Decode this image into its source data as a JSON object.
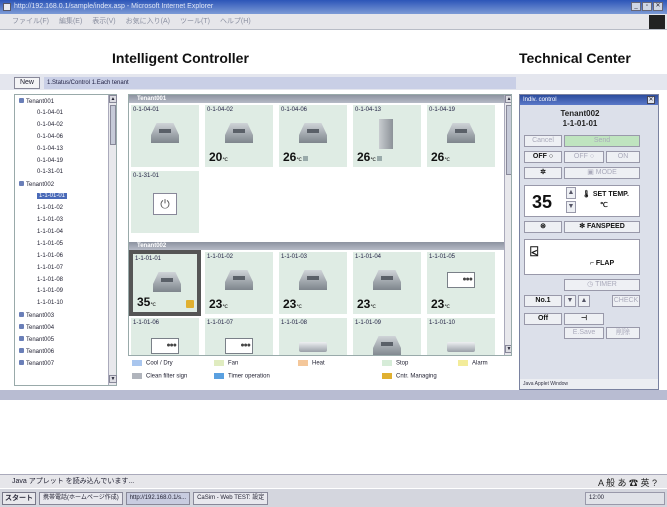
{
  "window": {
    "title": "http://192.168.0.1/sample/index.asp - Microsoft Internet Explorer",
    "menu": [
      "ファイル(F)",
      "編集(E)",
      "表示(V)",
      "お気に入り(A)",
      "ツール(T)",
      "ヘルプ(H)"
    ]
  },
  "header": {
    "left_title": "Intelligent Controller",
    "right_title": "Technical Center"
  },
  "tabbar": {
    "new_label": "New",
    "breadcrumb": "1.Status/Control  1.Each tenant"
  },
  "tree": [
    {
      "label": "Tenant001",
      "level": 0
    },
    {
      "label": "0-1-04-01",
      "level": 1
    },
    {
      "label": "0-1-04-02",
      "level": 1
    },
    {
      "label": "0-1-04-06",
      "level": 1
    },
    {
      "label": "0-1-04-13",
      "level": 1
    },
    {
      "label": "0-1-04-19",
      "level": 1
    },
    {
      "label": "0-1-31-01",
      "level": 1
    },
    {
      "label": "Tenant002",
      "level": 0
    },
    {
      "label": "1-1-01-01",
      "level": 1,
      "selected": true
    },
    {
      "label": "1-1-01-02",
      "level": 1
    },
    {
      "label": "1-1-01-03",
      "level": 1
    },
    {
      "label": "1-1-01-04",
      "level": 1
    },
    {
      "label": "1-1-01-05",
      "level": 1
    },
    {
      "label": "1-1-01-06",
      "level": 1
    },
    {
      "label": "1-1-01-07",
      "level": 1
    },
    {
      "label": "1-1-01-08",
      "level": 1
    },
    {
      "label": "1-1-01-09",
      "level": 1
    },
    {
      "label": "1-1-01-10",
      "level": 1
    },
    {
      "label": "Tenant003",
      "level": 0
    },
    {
      "label": "Tenant004",
      "level": 0
    },
    {
      "label": "Tenant005",
      "level": 0
    },
    {
      "label": "Tenant006",
      "level": 0
    },
    {
      "label": "Tenant007",
      "level": 0
    }
  ],
  "groups": [
    {
      "name": "Tenant001"
    },
    {
      "name": "Tenant002"
    }
  ],
  "units": [
    {
      "id": "0-1-04-01",
      "temp": "",
      "unit": ""
    },
    {
      "id": "0-1-04-02",
      "temp": "20",
      "unit": "℃"
    },
    {
      "id": "0-1-04-06",
      "temp": "26",
      "unit": "℃"
    },
    {
      "id": "0-1-04-13",
      "temp": "26",
      "unit": "℃"
    },
    {
      "id": "0-1-04-19",
      "temp": "26",
      "unit": "℃"
    },
    {
      "id": "0-1-31-01",
      "temp": "",
      "unit": ""
    },
    {
      "id": "1-1-01-01",
      "temp": "35",
      "unit": "℃"
    },
    {
      "id": "1-1-01-02",
      "temp": "23",
      "unit": "℃"
    },
    {
      "id": "1-1-01-03",
      "temp": "23",
      "unit": "℃"
    },
    {
      "id": "1-1-01-04",
      "temp": "23",
      "unit": "℃"
    },
    {
      "id": "1-1-01-05",
      "temp": "23",
      "unit": "℃"
    },
    {
      "id": "1-1-01-06",
      "temp": "",
      "unit": ""
    },
    {
      "id": "1-1-01-07",
      "temp": "",
      "unit": ""
    },
    {
      "id": "1-1-01-08",
      "temp": "",
      "unit": ""
    },
    {
      "id": "1-1-01-09",
      "temp": "",
      "unit": ""
    },
    {
      "id": "1-1-01-10",
      "temp": "",
      "unit": ""
    }
  ],
  "legend": [
    {
      "label": "Cool / Dry",
      "color": "#a9c6ee"
    },
    {
      "label": "Fan",
      "color": "#e0ecc0"
    },
    {
      "label": "Heat",
      "color": "#f4c79a"
    },
    {
      "label": "Stop",
      "color": "#d6ecd8"
    },
    {
      "label": "Alarm",
      "color": "#f3ec9a"
    },
    {
      "label": "Clean filter sign",
      "color": "#b0b4bc"
    },
    {
      "label": "Timer operation",
      "color": "#5aa0e0"
    },
    {
      "label": "Cntr. Managing",
      "color": "#e0b030"
    }
  ],
  "panel": {
    "title": "Indiv. control",
    "tenant": "Tenant002",
    "unit": "1-1-01-01",
    "cancel": "Cancel",
    "send": "Send",
    "off_on": "OFF ○",
    "off2": "OFF ○",
    "on": "ON",
    "mode": "MODE",
    "temp_value": "35",
    "set_temp": "SET TEMP.",
    "temp_unit": "℃",
    "fanspeed": "FANSPEED",
    "flap": "FLAP",
    "timer": "TIMER",
    "no": "No.1",
    "check": "CHECK",
    "off3": "Off",
    "esave": "E.Save",
    "del": "削除",
    "footer": "Java Applet Window"
  },
  "status": {
    "text": "Java アプレット を読み込んでいます...",
    "zone": "A 般 あ ☎ 英 ?"
  },
  "taskbar": {
    "start": "スタート",
    "tasks": [
      "携帯電話(ホームページ作成)",
      "http://192.168.0.1/s...",
      "CaSim - Web TEST: 設定"
    ],
    "tray": "12:00"
  }
}
